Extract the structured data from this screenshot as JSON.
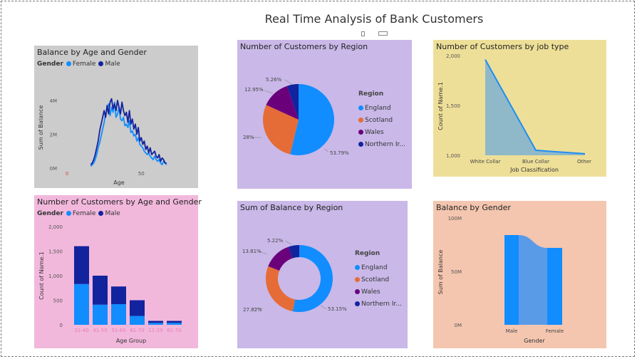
{
  "page": {
    "title": "Real Time Analysis of Bank Customers"
  },
  "colors": {
    "female": "#118DFF",
    "male": "#12239E",
    "england": "#118DFF",
    "scotland": "#E66C37",
    "wales": "#6B007B",
    "northern_ireland": "#12239E",
    "panel_gray": "#CCCCCC",
    "panel_purple": "#C9B8E8",
    "panel_yellow": "#EEDF98",
    "panel_pink": "#F2B8DC",
    "panel_peach": "#F4C6B0"
  },
  "charts": {
    "balance_age": {
      "title": "Balance by Age and Gender",
      "legend_label": "Gender",
      "legend": [
        "Female",
        "Male"
      ]
    },
    "region_count": {
      "title": "Number of Customers by Region",
      "legend_title": "Region",
      "legend": [
        "England",
        "Scotland",
        "Wales",
        "Northern Ir..."
      ]
    },
    "job": {
      "title": "Number of Customers by job type"
    },
    "age_count": {
      "title": "Number of Customers by Age and Gender",
      "legend_label": "Gender",
      "legend": [
        "Female",
        "Male"
      ]
    },
    "region_balance": {
      "title": "Sum of Balance by Region",
      "legend_title": "Region",
      "legend": [
        "England",
        "Scotland",
        "Wales",
        "Northern Ir..."
      ]
    },
    "gender_balance": {
      "title": "Balance by Gender"
    }
  },
  "chart_data": [
    {
      "type": "line",
      "title": "Balance by Age and Gender",
      "xlabel": "Age",
      "ylabel": "Sum of Balance",
      "xlim": [
        0,
        70
      ],
      "ylim": [
        0,
        4800000
      ],
      "xticks": [
        "0",
        "50"
      ],
      "yticks": [
        "0M",
        "2M",
        "4M"
      ],
      "x": [
        16,
        17,
        18,
        19,
        20,
        21,
        22,
        23,
        24,
        25,
        26,
        27,
        28,
        29,
        30,
        31,
        32,
        33,
        34,
        35,
        36,
        37,
        38,
        39,
        40,
        41,
        42,
        43,
        44,
        45,
        46,
        47,
        48,
        49,
        50,
        51,
        52,
        53,
        54,
        55,
        56,
        57,
        58,
        59,
        60,
        61,
        62,
        63,
        64,
        65,
        66,
        67
      ],
      "series": [
        {
          "name": "Female",
          "values": [
            0.1,
            0.2,
            0.3,
            0.5,
            0.8,
            1.2,
            1.5,
            1.9,
            2.3,
            2.7,
            3.2,
            3.5,
            3.8,
            3.1,
            3.6,
            3.3,
            3.9,
            3.0,
            3.2,
            3.6,
            2.9,
            2.8,
            3.0,
            2.5,
            2.6,
            2.4,
            2.8,
            2.1,
            2.2,
            1.9,
            2.0,
            1.6,
            1.8,
            1.4,
            1.3,
            1.2,
            1.0,
            0.9,
            0.8,
            0.9,
            0.7,
            0.6,
            0.5,
            0.7,
            0.5,
            0.4,
            0.5,
            0.3,
            0.2,
            0.4,
            0.3,
            0.2
          ]
        },
        {
          "name": "Male",
          "values": [
            0.2,
            0.3,
            0.5,
            0.8,
            1.2,
            1.6,
            2.2,
            2.6,
            3.0,
            3.4,
            3.0,
            3.7,
            3.2,
            3.9,
            4.1,
            3.5,
            3.8,
            3.4,
            4.0,
            3.6,
            3.2,
            3.9,
            3.4,
            3.1,
            3.3,
            2.7,
            3.4,
            2.6,
            2.9,
            2.3,
            2.6,
            2.0,
            2.4,
            1.6,
            1.8,
            1.4,
            1.6,
            1.1,
            1.3,
            0.9,
            1.2,
            0.8,
            0.9,
            1.0,
            0.7,
            0.6,
            0.8,
            0.4,
            0.6,
            0.5,
            0.3,
            0.3
          ]
        }
      ],
      "units": "millions",
      "legend_position": "top-left"
    },
    {
      "type": "pie",
      "title": "Number of Customers by Region",
      "categories": [
        "England",
        "Scotland",
        "Wales",
        "Northern Ir..."
      ],
      "values": [
        53.79,
        28,
        12.95,
        5.26
      ],
      "labels": [
        "53.79%",
        "28%",
        "12.95%",
        "5.26%"
      ],
      "legend_title": "Region",
      "legend_position": "right"
    },
    {
      "type": "area",
      "title": "Number of Customers by job type",
      "xlabel": "Job Classification",
      "ylabel": "Count of Name.1",
      "categories": [
        "White Collar",
        "Blue Collar",
        "Other"
      ],
      "values": [
        1960,
        1050,
        1015
      ],
      "ylim": [
        1000,
        2000
      ],
      "yticks": [
        "1,000",
        "1,500",
        "2,000"
      ]
    },
    {
      "type": "bar",
      "title": "Number of Customers by Age and Gender",
      "xlabel": "Age Group",
      "ylabel": "Count of Name.1",
      "categories": [
        "31-40",
        "41-50",
        "51-60",
        "61-70",
        "11-20",
        "61-70"
      ],
      "series": [
        {
          "name": "Female",
          "values": [
            830,
            410,
            420,
            180,
            40,
            40
          ]
        },
        {
          "name": "Male",
          "values": [
            770,
            590,
            360,
            320,
            40,
            40
          ]
        }
      ],
      "ylim": [
        0,
        2000
      ],
      "yticks": [
        "0",
        "500",
        "1,000",
        "1,500",
        "2,000"
      ],
      "stacked": true,
      "legend_position": "top-left"
    },
    {
      "type": "pie",
      "title": "Sum of Balance by Region",
      "donut": true,
      "categories": [
        "England",
        "Scotland",
        "Wales",
        "Northern Ir..."
      ],
      "values": [
        53.15,
        27.82,
        13.81,
        5.22
      ],
      "labels": [
        "53.15%",
        "27.82%",
        "13.81%",
        "5.22%"
      ],
      "legend_title": "Region",
      "legend_position": "right"
    },
    {
      "type": "bar",
      "title": "Balance by Gender",
      "xlabel": "Gender",
      "ylabel": "Sum of Balance",
      "categories": [
        "Male",
        "Female"
      ],
      "values": [
        84000000,
        72000000
      ],
      "ylim": [
        0,
        100000000
      ],
      "yticks": [
        "0M",
        "50M",
        "100M"
      ]
    }
  ]
}
